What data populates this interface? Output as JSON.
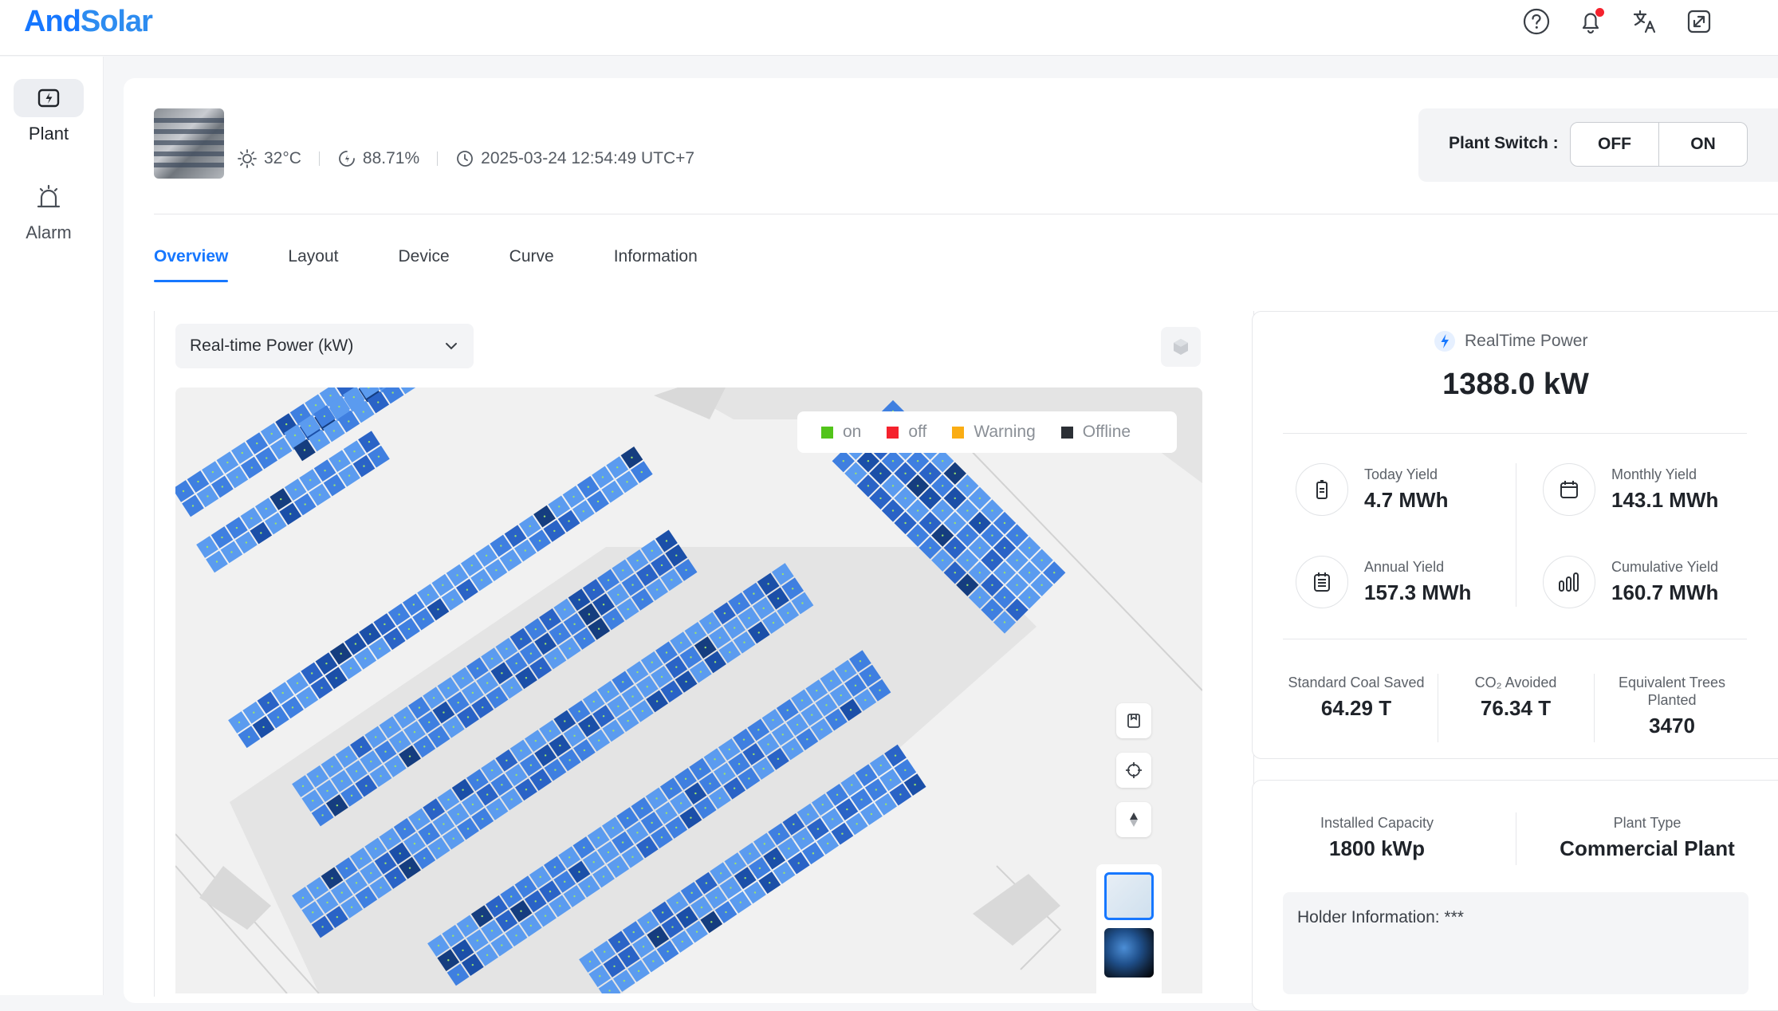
{
  "app": {
    "logo_part1": "And",
    "logo_part2": "Solar",
    "header_icons": [
      "help-icon",
      "bell-icon",
      "translate-icon",
      "expand-icon"
    ],
    "notification_dot_color": "#f5222d"
  },
  "sidebar": {
    "items": [
      {
        "label": "Plant",
        "icon": "plant-lightning-icon",
        "active": true
      },
      {
        "label": "Alarm",
        "icon": "alarm-siren-icon",
        "active": false
      }
    ]
  },
  "plant": {
    "temperature": "32°C",
    "efficiency": "88.71%",
    "timestamp": "2025-03-24 12:54:49 UTC+7",
    "switch_label": "Plant Switch :",
    "switch_off": "OFF",
    "switch_on": "ON"
  },
  "tabs": [
    {
      "label": "Overview",
      "active": true
    },
    {
      "label": "Layout",
      "active": false
    },
    {
      "label": "Device",
      "active": false
    },
    {
      "label": "Curve",
      "active": false
    },
    {
      "label": "Information",
      "active": false
    }
  ],
  "map": {
    "metric_select": "Real-time Power (kW)",
    "legend": [
      {
        "label": "on",
        "color": "#52c41a"
      },
      {
        "label": "off",
        "color": "#f5222d"
      },
      {
        "label": "Warning",
        "color": "#faad14"
      },
      {
        "label": "Offline",
        "color": "#2b2f35"
      }
    ],
    "panel_colors": [
      "#5b9bef",
      "#3f7fe0",
      "#2a63c6",
      "#1b4fa8",
      "#153d7f"
    ]
  },
  "realtime": {
    "title": "RealTime Power",
    "value": "1388.0 kW"
  },
  "yields": {
    "today_label": "Today Yield",
    "today_value": "4.7 MWh",
    "monthly_label": "Monthly Yield",
    "monthly_value": "143.1 MWh",
    "annual_label": "Annual Yield",
    "annual_value": "157.3 MWh",
    "cumulative_label": "Cumulative Yield",
    "cumulative_value": "160.7 MWh"
  },
  "environment": {
    "coal_label": "Standard Coal Saved",
    "coal_value": "64.29 T",
    "co2_label": "CO₂ Avoided",
    "co2_value": "76.34 T",
    "trees_label": "Equivalent Trees Planted",
    "trees_value": "3470"
  },
  "plant_info": {
    "capacity_label": "Installed Capacity",
    "capacity_value": "1800 kWp",
    "type_label": "Plant Type",
    "type_value": "Commercial Plant",
    "holder": "Holder Information: ***"
  }
}
